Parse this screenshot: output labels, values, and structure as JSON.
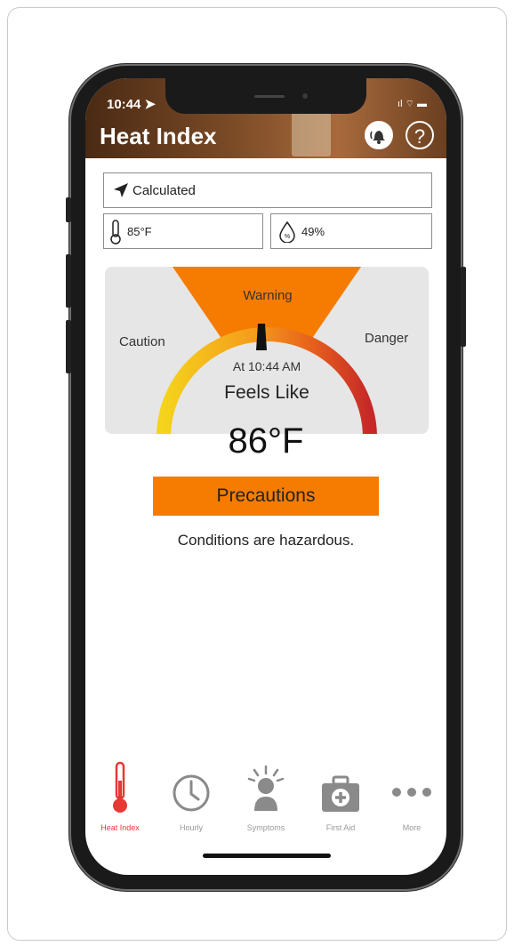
{
  "status": {
    "time": "10:44 ➤",
    "signal": "ıl ⌔ ▬"
  },
  "header": {
    "title": "Heat Index",
    "alert_icon": "alert-bell-icon",
    "help_icon": "?"
  },
  "location": {
    "icon": "location-arrow-icon",
    "label": "Calculated"
  },
  "temperature": {
    "icon": "thermometer-icon",
    "value": "85°F"
  },
  "humidity": {
    "icon": "humidity-drop-icon",
    "value": "49%"
  },
  "gauge": {
    "caution_label": "Caution",
    "warning_label": "Warning",
    "danger_label": "Danger",
    "time_label": "At 10:44 AM",
    "feels_like_label": "Feels Like",
    "feels_like_value": "86°F",
    "colors": {
      "warning": "#F57C00",
      "caution": "#F5D31C",
      "danger": "#C62828"
    }
  },
  "precautions": {
    "label": "Precautions"
  },
  "conditions": {
    "text": "Conditions are hazardous."
  },
  "tabs": [
    {
      "label": "Heat Index",
      "icon": "thermometer-icon",
      "active": true
    },
    {
      "label": "Hourly",
      "icon": "clock-icon",
      "active": false
    },
    {
      "label": "Symptoms",
      "icon": "person-symptoms-icon",
      "active": false
    },
    {
      "label": "First Aid",
      "icon": "first-aid-kit-icon",
      "active": false
    },
    {
      "label": "More",
      "icon": "more-dots-icon",
      "active": false
    }
  ],
  "accent_color": "#E53935"
}
